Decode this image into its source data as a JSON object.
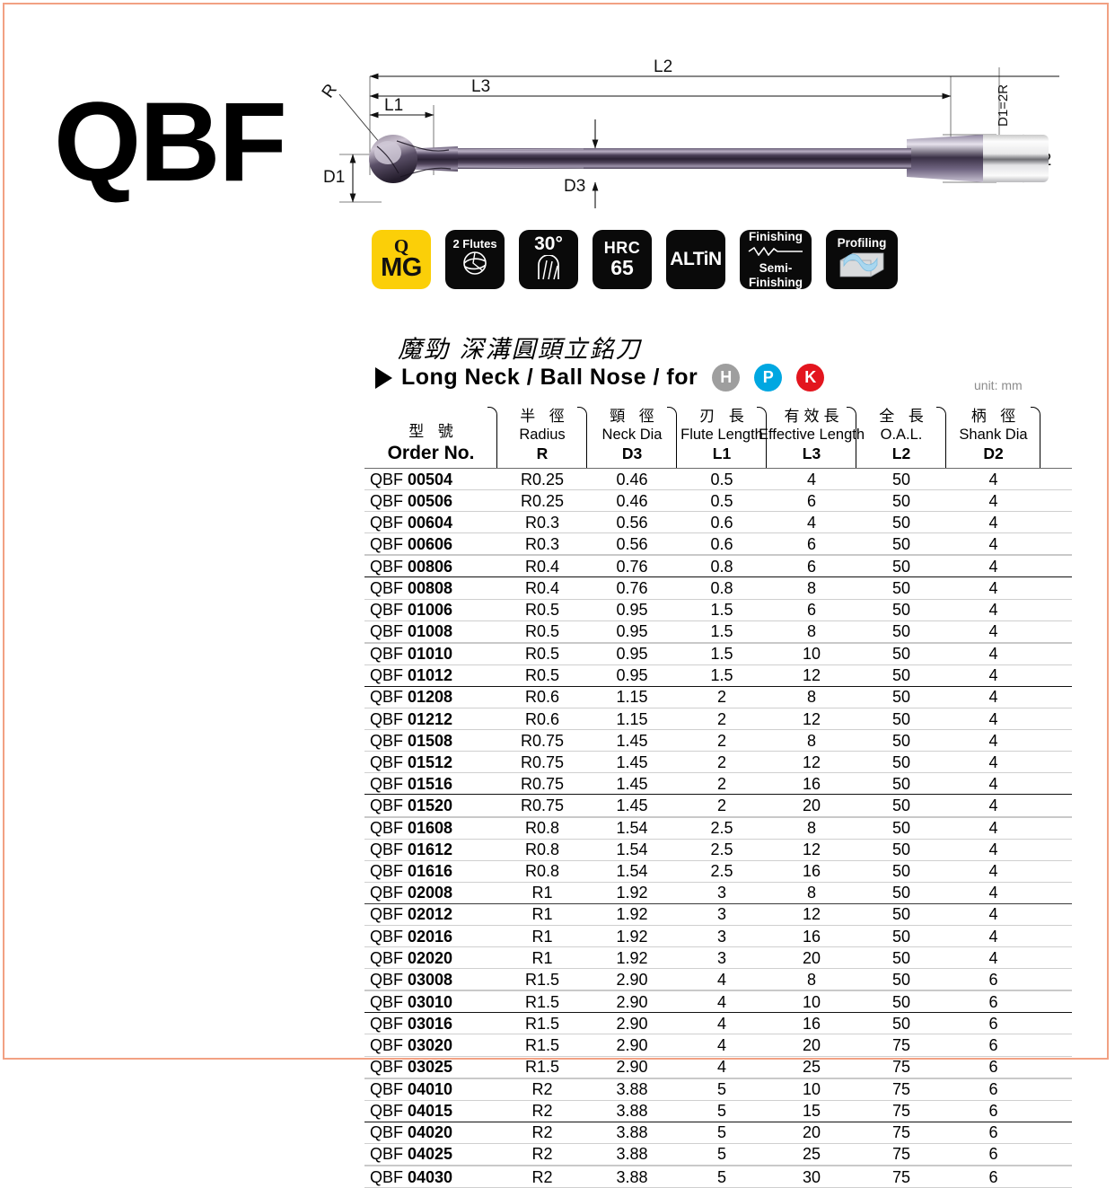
{
  "product_code": "QBF",
  "drawing": {
    "labels": {
      "r": "R",
      "d1": "D1",
      "d2": "D2",
      "d3": "D3",
      "l1": "L1",
      "l2": "L2",
      "l3": "L3",
      "d1_eq": "D1=2R"
    }
  },
  "badges": [
    {
      "name": "mg-badge",
      "line1": "Q",
      "line2": "MG",
      "style": "yellow"
    },
    {
      "name": "flutes-badge",
      "line1": "2 Flutes",
      "line2": "",
      "style": "dark"
    },
    {
      "name": "helix-badge",
      "line1": "30°",
      "line2": "",
      "style": "dark"
    },
    {
      "name": "hardness-badge",
      "line1": "HRC",
      "line2": "65",
      "style": "dark"
    },
    {
      "name": "coating-badge",
      "line1": "ALTiN",
      "line2": "",
      "style": "dark"
    },
    {
      "name": "finishing-badge",
      "line1": "Finishing",
      "line2": "Semi-",
      "line3": "Finishing",
      "style": "dark"
    },
    {
      "name": "profiling-badge",
      "line1": "Profiling",
      "line2": "",
      "style": "dark"
    }
  ],
  "title": {
    "chinese": "魔勁  深溝圓頭立銘刀",
    "english": "Long Neck / Ball Nose / for",
    "materials": [
      {
        "letter": "H",
        "color": "#9e9e9e"
      },
      {
        "letter": "P",
        "color": "#00a7e1"
      },
      {
        "letter": "K",
        "color": "#e3151e"
      }
    ],
    "unit": "unit: mm"
  },
  "colors": {
    "accent_yellow": "#fbcf08",
    "frame": "#f2a183",
    "coating": "#3b3247"
  },
  "table": {
    "columns": [
      {
        "cn": "型 號",
        "en": "Order No.",
        "sym": ""
      },
      {
        "cn": "半 徑",
        "en": "Radius",
        "sym": "R"
      },
      {
        "cn": "頸 徑",
        "en": "Neck Dia",
        "sym": "D3"
      },
      {
        "cn": "刃 長",
        "en": "Flute Length",
        "sym": "L1"
      },
      {
        "cn": "有效長",
        "en": "Effective Length",
        "sym": "L3"
      },
      {
        "cn": "全 長",
        "en": "O.A.L.",
        "sym": "L2"
      },
      {
        "cn": "柄 徑",
        "en": "Shank Dia",
        "sym": "D2"
      }
    ],
    "prefix": "QBF",
    "rows": [
      {
        "no": "00504",
        "r": "R0.25",
        "d3": "0.46",
        "l1": "0.5",
        "l3": "4",
        "l2": "50",
        "d2": "4",
        "sep": "thin"
      },
      {
        "no": "00506",
        "r": "R0.25",
        "d3": "0.46",
        "l1": "0.5",
        "l3": "6",
        "l2": "50",
        "d2": "4",
        "sep": "thin"
      },
      {
        "no": "00604",
        "r": "R0.3",
        "d3": "0.56",
        "l1": "0.6",
        "l3": "4",
        "l2": "50",
        "d2": "4",
        "sep": "thin"
      },
      {
        "no": "00606",
        "r": "R0.3",
        "d3": "0.56",
        "l1": "0.6",
        "l3": "6",
        "l2": "50",
        "d2": "4",
        "sep": "soft"
      },
      {
        "no": "00806",
        "r": "R0.4",
        "d3": "0.76",
        "l1": "0.8",
        "l3": "6",
        "l2": "50",
        "d2": "4",
        "sep": "thick"
      },
      {
        "no": "00808",
        "r": "R0.4",
        "d3": "0.76",
        "l1": "0.8",
        "l3": "8",
        "l2": "50",
        "d2": "4",
        "sep": "thin"
      },
      {
        "no": "01006",
        "r": "R0.5",
        "d3": "0.95",
        "l1": "1.5",
        "l3": "6",
        "l2": "50",
        "d2": "4",
        "sep": "thin"
      },
      {
        "no": "01008",
        "r": "R0.5",
        "d3": "0.95",
        "l1": "1.5",
        "l3": "8",
        "l2": "50",
        "d2": "4",
        "sep": "soft"
      },
      {
        "no": "01010",
        "r": "R0.5",
        "d3": "0.95",
        "l1": "1.5",
        "l3": "10",
        "l2": "50",
        "d2": "4",
        "sep": "thin"
      },
      {
        "no": "01012",
        "r": "R0.5",
        "d3": "0.95",
        "l1": "1.5",
        "l3": "12",
        "l2": "50",
        "d2": "4",
        "sep": "thick"
      },
      {
        "no": "01208",
        "r": "R0.6",
        "d3": "1.15",
        "l1": "2",
        "l3": "8",
        "l2": "50",
        "d2": "4",
        "sep": "thin"
      },
      {
        "no": "01212",
        "r": "R0.6",
        "d3": "1.15",
        "l1": "2",
        "l3": "12",
        "l2": "50",
        "d2": "4",
        "sep": "thin"
      },
      {
        "no": "01508",
        "r": "R0.75",
        "d3": "1.45",
        "l1": "2",
        "l3": "8",
        "l2": "50",
        "d2": "4",
        "sep": "thin"
      },
      {
        "no": "01512",
        "r": "R0.75",
        "d3": "1.45",
        "l1": "2",
        "l3": "12",
        "l2": "50",
        "d2": "4",
        "sep": "thin"
      },
      {
        "no": "01516",
        "r": "R0.75",
        "d3": "1.45",
        "l1": "2",
        "l3": "16",
        "l2": "50",
        "d2": "4",
        "sep": "thick"
      },
      {
        "no": "01520",
        "r": "R0.75",
        "d3": "1.45",
        "l1": "2",
        "l3": "20",
        "l2": "50",
        "d2": "4",
        "sep": "soft"
      },
      {
        "no": "01608",
        "r": "R0.8",
        "d3": "1.54",
        "l1": "2.5",
        "l3": "8",
        "l2": "50",
        "d2": "4",
        "sep": "thin"
      },
      {
        "no": "01612",
        "r": "R0.8",
        "d3": "1.54",
        "l1": "2.5",
        "l3": "12",
        "l2": "50",
        "d2": "4",
        "sep": "thin"
      },
      {
        "no": "01616",
        "r": "R0.8",
        "d3": "1.54",
        "l1": "2.5",
        "l3": "16",
        "l2": "50",
        "d2": "4",
        "sep": "thin"
      },
      {
        "no": "02008",
        "r": "R1",
        "d3": "1.92",
        "l1": "3",
        "l3": "8",
        "l2": "50",
        "d2": "4",
        "sep": "group"
      },
      {
        "no": "02012",
        "r": "R1",
        "d3": "1.92",
        "l1": "3",
        "l3": "12",
        "l2": "50",
        "d2": "4",
        "sep": "thin"
      },
      {
        "no": "02016",
        "r": "R1",
        "d3": "1.92",
        "l1": "3",
        "l3": "16",
        "l2": "50",
        "d2": "4",
        "sep": "thin"
      },
      {
        "no": "02020",
        "r": "R1",
        "d3": "1.92",
        "l1": "3",
        "l3": "20",
        "l2": "50",
        "d2": "4",
        "sep": "thin"
      },
      {
        "no": "03008",
        "r": "R1.5",
        "d3": "2.90",
        "l1": "4",
        "l3": "8",
        "l2": "50",
        "d2": "6",
        "sep": "soft"
      },
      {
        "no": "03010",
        "r": "R1.5",
        "d3": "2.90",
        "l1": "4",
        "l3": "10",
        "l2": "50",
        "d2": "6",
        "sep": "thick"
      },
      {
        "no": "03016",
        "r": "R1.5",
        "d3": "2.90",
        "l1": "4",
        "l3": "16",
        "l2": "50",
        "d2": "6",
        "sep": "thin"
      },
      {
        "no": "03020",
        "r": "R1.5",
        "d3": "2.90",
        "l1": "4",
        "l3": "20",
        "l2": "75",
        "d2": "6",
        "sep": "thin"
      },
      {
        "no": "03025",
        "r": "R1.5",
        "d3": "2.90",
        "l1": "4",
        "l3": "25",
        "l2": "75",
        "d2": "6",
        "sep": "soft"
      },
      {
        "no": "04010",
        "r": "R2",
        "d3": "3.88",
        "l1": "5",
        "l3": "10",
        "l2": "75",
        "d2": "6",
        "sep": "thin"
      },
      {
        "no": "04015",
        "r": "R2",
        "d3": "3.88",
        "l1": "5",
        "l3": "15",
        "l2": "75",
        "d2": "6",
        "sep": "thick"
      },
      {
        "no": "04020",
        "r": "R2",
        "d3": "3.88",
        "l1": "5",
        "l3": "20",
        "l2": "75",
        "d2": "6",
        "sep": "thin"
      },
      {
        "no": "04025",
        "r": "R2",
        "d3": "3.88",
        "l1": "5",
        "l3": "25",
        "l2": "75",
        "d2": "6",
        "sep": "soft"
      },
      {
        "no": "04030",
        "r": "R2",
        "d3": "3.88",
        "l1": "5",
        "l3": "30",
        "l2": "75",
        "d2": "6",
        "sep": "thin"
      }
    ]
  }
}
